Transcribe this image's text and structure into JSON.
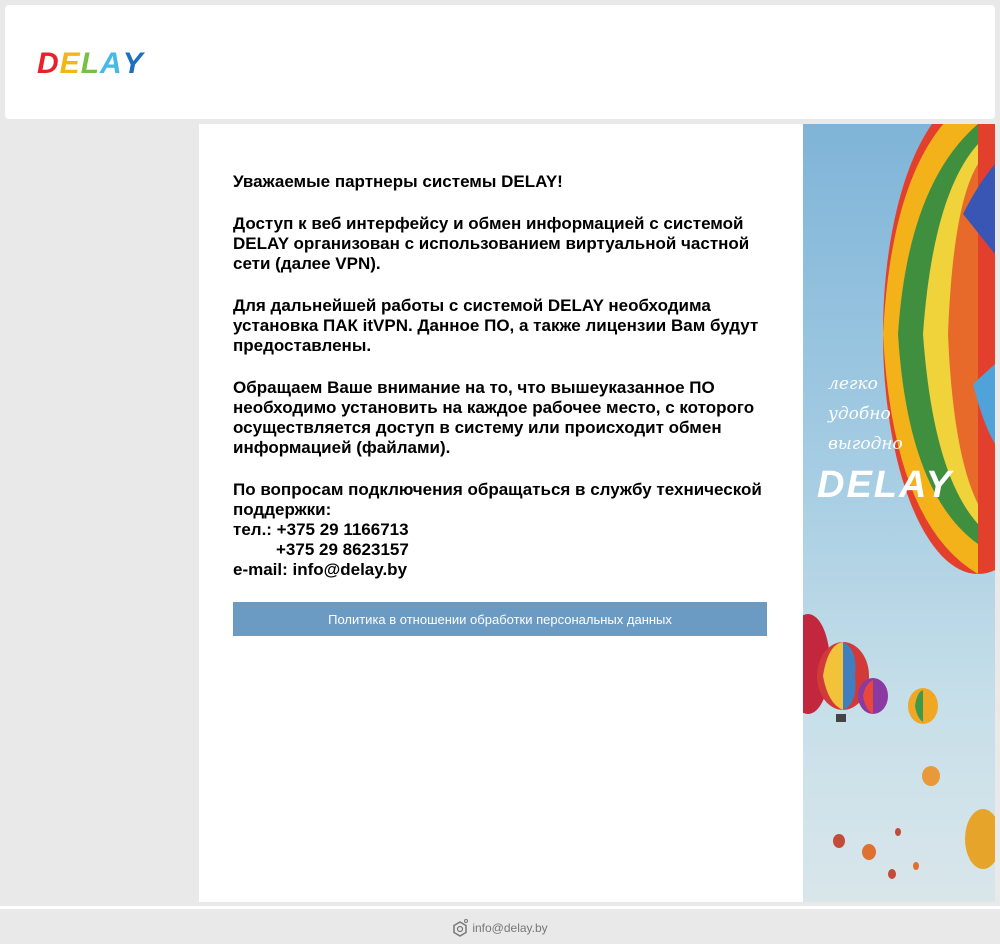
{
  "header": {
    "logo_letters": [
      "D",
      "E",
      "L",
      "A",
      "Y"
    ],
    "logo_colors": [
      "#e8202a",
      "#f2b61b",
      "#77c043",
      "#47b9e6",
      "#1d6fc0"
    ]
  },
  "content": {
    "greeting": "Уважаемые партнеры системы DELAY!",
    "para1": "Доступ к веб интерфейсу и обмен информацией с системой DELAY организован с использованием виртуальной частной сети (далее VPN).",
    "para2": "Для дальнейшей работы с системой DELAY необходима установка ПАК itVPN. Данное ПО, а также лицензии Вам будут предоставлены.",
    "para3": "Обращаем Ваше внимание на то, что вышеуказанное ПО необходимо установить на каждое рабочее место, с которого осуществляется доступ в систему или происходит обмен информацией (файлами).",
    "support_intro": "По вопросам подключения обращаться в службу технической поддержки:",
    "phone1": "тел.: +375 29 1166713",
    "phone2": "+375 29 8623157",
    "email": "e-mail: info@delay.by",
    "policy_button": "Политика в отношении обработки персональных данных"
  },
  "banner": {
    "tag1": "легко",
    "tag2": "удобно",
    "tag3": "выгодно",
    "logo": "DELAY"
  },
  "footer": {
    "email": "info@delay.by"
  }
}
